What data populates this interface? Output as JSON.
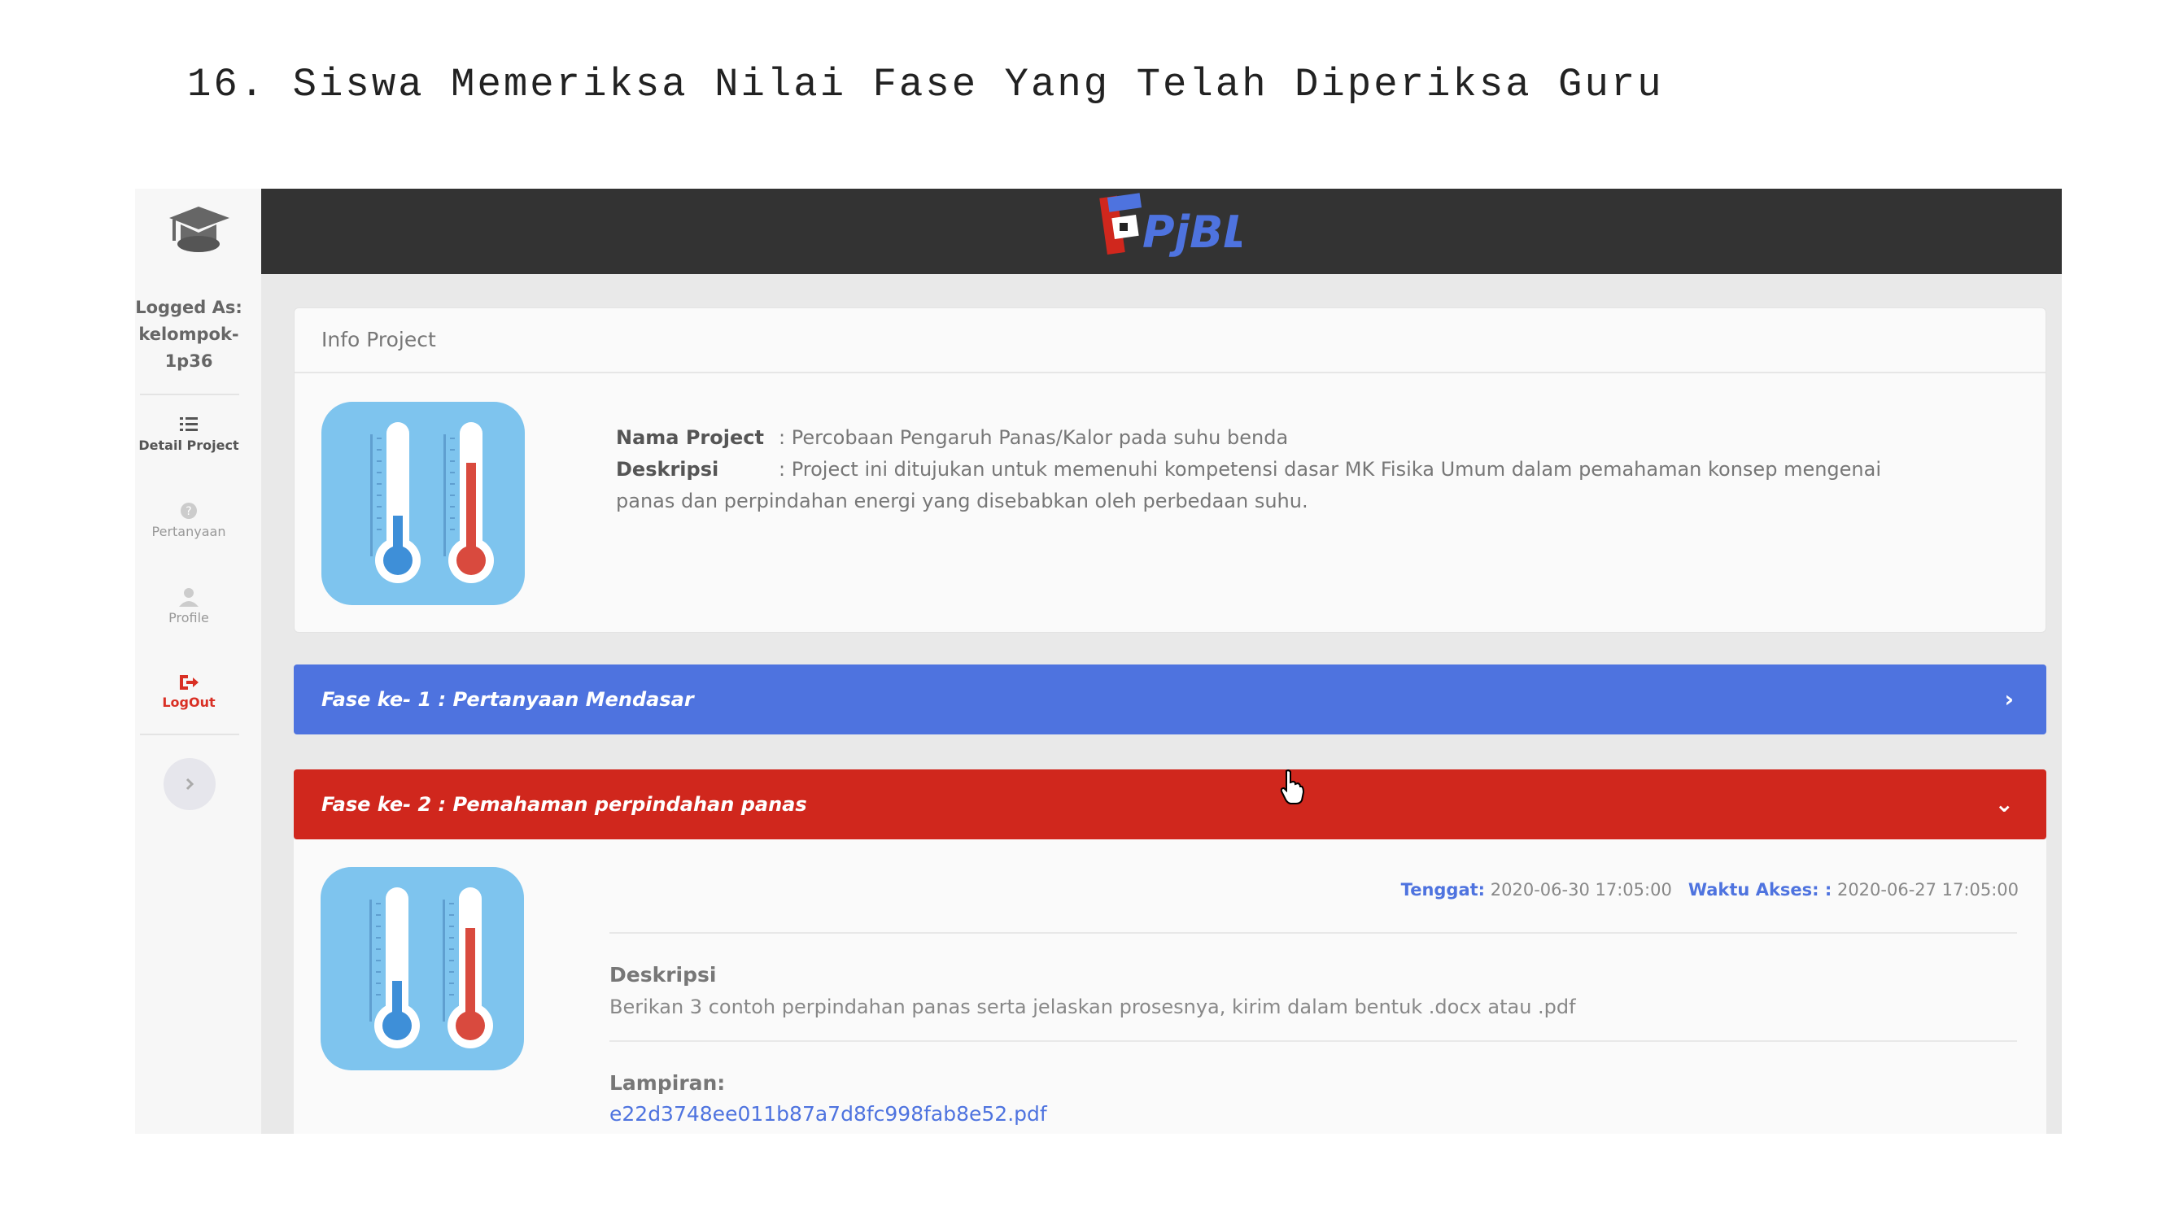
{
  "document": {
    "heading": "16. Siswa Memeriksa Nilai Fase Yang Telah Diperiksa Guru"
  },
  "sidebar": {
    "logged_as_label": "Logged As:",
    "username_line1": "kelompok-",
    "username_line2": "1p36",
    "items": [
      {
        "label": "Detail Project",
        "icon": "list-icon",
        "active": true
      },
      {
        "label": "Pertanyaan",
        "icon": "question-icon",
        "active": false
      },
      {
        "label": "Profile",
        "icon": "user-icon",
        "active": false
      },
      {
        "label": "LogOut",
        "icon": "logout-icon",
        "active": false
      }
    ],
    "toggle_icon": "chevron-right-icon"
  },
  "topbar": {
    "brand_text": "PjBL"
  },
  "info_project": {
    "card_title": "Info Project",
    "nama_label": "Nama Project",
    "nama_value": ": Percobaan Pengaruh Panas/Kalor pada suhu benda",
    "deskripsi_label": "Deskripsi",
    "deskripsi_value": ": Project ini ditujukan untuk memenuhi kompetensi dasar MK Fisika Umum dalam pemahaman konsep mengenai",
    "deskripsi_value_cont": "panas dan perpindahan energi yang disebabkan oleh perbedaan suhu.",
    "thumbnail_icon": "thermometer-icon"
  },
  "phases": [
    {
      "title": "Fase ke- 1 : Pertanyaan Mendasar",
      "color": "#4e73df",
      "expanded": false
    },
    {
      "title": "Fase ke- 2 : Pemahaman perpindahan panas",
      "color": "#d0271d",
      "expanded": true
    }
  ],
  "phase_detail": {
    "tenggat_label": "Tenggat:",
    "tenggat_value": "2020-06-30 17:05:00",
    "akses_label": "Waktu Akses: :",
    "akses_value": "2020-06-27 17:05:00",
    "deskripsi_label": "Deskripsi",
    "deskripsi_text": "Berikan 3 contoh perpindahan panas serta jelaskan prosesnya, kirim dalam bentuk .docx atau .pdf",
    "lampiran_label": "Lampiran:",
    "lampiran_file": "e22d3748ee011b87a7d8fc998fab8e52.pdf"
  },
  "colors": {
    "topbar": "#333333",
    "primary": "#4e73df",
    "danger": "#d0271d",
    "thumb_bg": "#7ec4ee"
  }
}
